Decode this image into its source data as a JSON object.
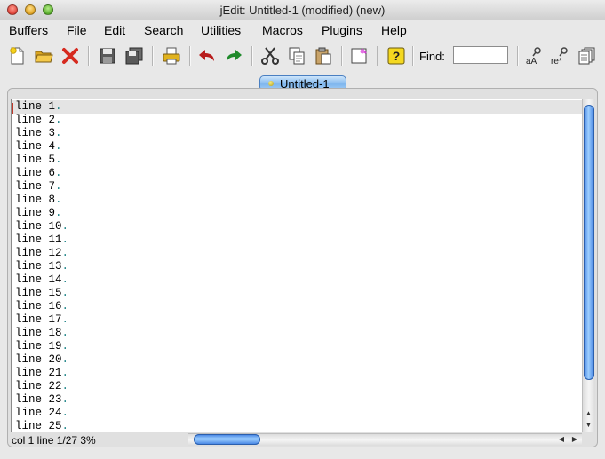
{
  "window": {
    "title": "jEdit: Untitled-1 (modified) (new)"
  },
  "menubar": [
    "Buffers",
    "File",
    "Edit",
    "Search",
    "Utilities",
    "Macros",
    "Plugins",
    "Help"
  ],
  "toolbar": {
    "buttons": [
      "new-file-icon",
      "open-folder-icon",
      "close-x-icon",
      "save-icon",
      "save-all-icon",
      "print-icon",
      "undo-icon",
      "redo-icon",
      "cut-icon",
      "copy-icon",
      "paste-icon",
      "new-view-icon",
      "help-icon"
    ],
    "find_label": "Find:",
    "find_value": "",
    "right_buttons": [
      "case-search-icon",
      "regex-search-icon",
      "hypersearch-icon"
    ],
    "colors": {
      "close": "#d62a1f",
      "undo": "#b81c1c",
      "redo": "#1f8a2b",
      "help": "#f4d820"
    }
  },
  "tabs": [
    {
      "label": "Untitled-1",
      "active": true
    }
  ],
  "editor": {
    "lines": [
      "line 1",
      "line 2",
      "line 3",
      "line 4",
      "line 5",
      "line 6",
      "line 7",
      "line 8",
      "line 9",
      "line 10",
      "line 11",
      "line 12",
      "line 13",
      "line 14",
      "line 15",
      "line 16",
      "line 17",
      "line 18",
      "line 19",
      "line 20",
      "line 21",
      "line 22",
      "line 23",
      "line 24",
      "line 25"
    ],
    "eol_marker": ".",
    "eol_color": "#22868a"
  },
  "status": {
    "text": "col 1 line 1/27 3%"
  }
}
